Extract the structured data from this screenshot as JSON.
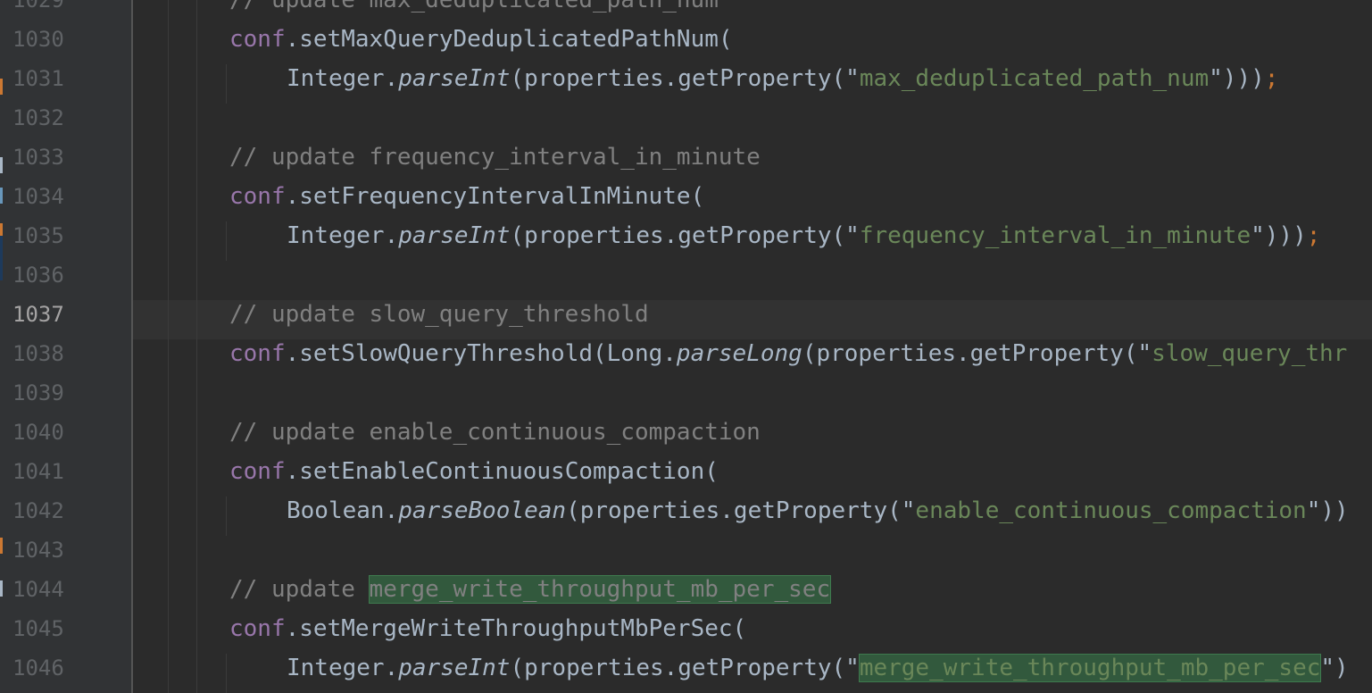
{
  "editor": {
    "current_line": "1037",
    "colors": {
      "background": "#2b2b2b",
      "gutter": "#313335",
      "comment": "#808080",
      "field": "#9876aa",
      "string": "#6a8759",
      "keyword_semicolon": "#cc7832",
      "default_text": "#a9b7c6",
      "search_highlight": "#32593d"
    },
    "lines": [
      {
        "num": "1029",
        "comment": "// update max_deduplicated_path_num"
      },
      {
        "num": "1030",
        "field": "conf",
        "dot": ".",
        "method": "setMaxQueryDeduplicatedPathNum("
      },
      {
        "num": "1031",
        "cls": "Integer.",
        "fn": "parseInt",
        "mid": "(properties.getProperty(\"",
        "str": "max_deduplicated_path_num",
        "tail": "\")))",
        "semi": ";"
      },
      {
        "num": "1032"
      },
      {
        "num": "1033",
        "comment": "// update frequency_interval_in_minute"
      },
      {
        "num": "1034",
        "field": "conf",
        "dot": ".",
        "method": "setFrequencyIntervalInMinute("
      },
      {
        "num": "1035",
        "cls": "Integer.",
        "fn": "parseInt",
        "mid": "(properties.getProperty(\"",
        "str": "frequency_interval_in_minute",
        "tail": "\")))",
        "semi": ";"
      },
      {
        "num": "1036"
      },
      {
        "num": "1037",
        "comment": "// update slow_query_threshold"
      },
      {
        "num": "1038",
        "field": "conf",
        "dot": ".",
        "method": "setSlowQueryThreshold(Long.",
        "fn": "parseLong",
        "mid": "(properties.getProperty(\"",
        "str": "slow_query_thr"
      },
      {
        "num": "1039"
      },
      {
        "num": "1040",
        "comment": "// update enable_continuous_compaction"
      },
      {
        "num": "1041",
        "field": "conf",
        "dot": ".",
        "method": "setEnableContinuousCompaction("
      },
      {
        "num": "1042",
        "cls": "Boolean.",
        "fn": "parseBoolean",
        "mid": "(properties.getProperty(\"",
        "str": "enable_continuous_compaction",
        "tail": "\"))"
      },
      {
        "num": "1043"
      },
      {
        "num": "1044",
        "comment_prefix": "// update ",
        "highlight": "merge_write_throughput_mb_per_sec"
      },
      {
        "num": "1045",
        "field": "conf",
        "dot": ".",
        "method": "setMergeWriteThroughputMbPerSec("
      },
      {
        "num": "1046",
        "cls": "Integer.",
        "fn": "parseInt",
        "mid": "(properties.getProperty(\"",
        "highlight": "merge_write_throughput_mb_per_sec",
        "tail": "\")"
      }
    ]
  }
}
